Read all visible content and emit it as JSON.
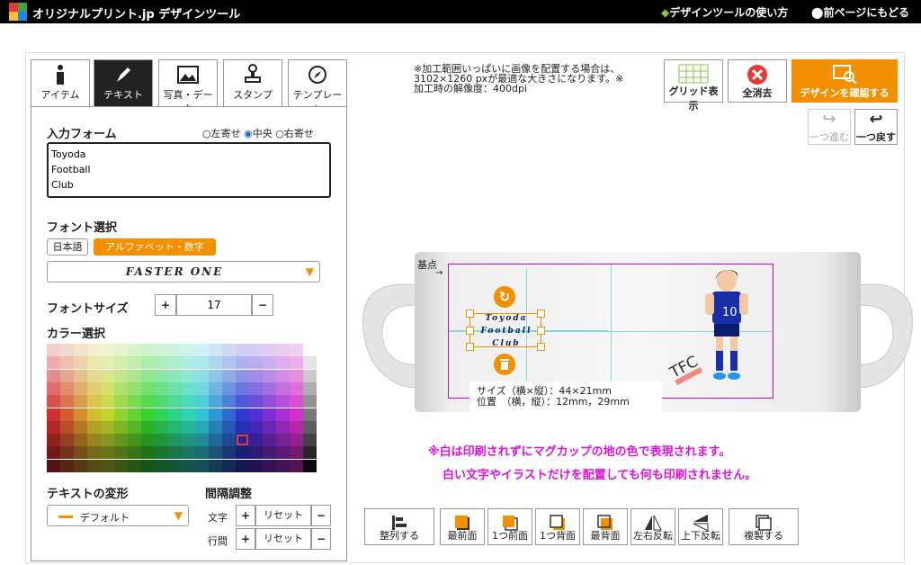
{
  "header": {
    "brand": "オリジナルプリント.jp",
    "app_title": "デザインツール",
    "help_link": "デザインツールの使い方",
    "back_link": "前ページにもどる"
  },
  "tool_tabs": [
    {
      "label": "アイテム",
      "icon": "info-icon"
    },
    {
      "label": "テキスト",
      "icon": "pen-icon"
    },
    {
      "label": "写真・データ",
      "icon": "image-icon"
    },
    {
      "label": "スタンプ",
      "icon": "stamp-icon"
    },
    {
      "label": "テンプレート",
      "icon": "compass-icon"
    }
  ],
  "text_panel": {
    "input_label": "入力フォーム",
    "align_left": "左寄せ",
    "align_center": "中央",
    "align_right": "右寄せ",
    "input_value": "Toyoda\nFootball\nClub",
    "font_label": "フォント選択",
    "font_tab_ja": "日本語",
    "font_tab_alpha": "アルファベット・数字",
    "font_value": "Faster One",
    "size_label": "フォントサイズ",
    "size_value": "17",
    "color_label": "カラー選択",
    "transform_label": "テキストの変形",
    "transform_value": "デフォルト",
    "spacing_label": "間隔調整",
    "char_label": "文字",
    "line_label": "行間",
    "reset": "リセット",
    "plus": "+",
    "minus": "−"
  },
  "notice": "※加工範囲いっぱいに画像を配置する場合は、3102×1260 pxが最適な大きさになります。※加工時の解像度：400dpi",
  "toolbar": {
    "grid": "グリッド表示",
    "clear": "全消去",
    "confirm": "デザインを確認する",
    "redo": "一つ進む",
    "undo": "一つ戻す"
  },
  "canvas": {
    "origin_label": "基点",
    "design_lines": [
      "Toyoda",
      "Football",
      "Club"
    ],
    "size_info": "サイズ（横×縦）：44×21mm",
    "position_info": "位置　（横，縦）：12mm，29mm",
    "player_number": "10",
    "badge_text": "TFC"
  },
  "warnings": {
    "line1": "※白は印刷されずにマグカップの地の色で表現されます。",
    "line2": "白い文字やイラストだけを配置しても何も印刷されません。"
  },
  "bottom_buttons": [
    {
      "label": "整列する"
    },
    {
      "label": "最前面"
    },
    {
      "label": "1つ前面"
    },
    {
      "label": "1つ背面"
    },
    {
      "label": "最背面"
    },
    {
      "label": "左右反転"
    },
    {
      "label": "上下反転"
    },
    {
      "label": "複製する"
    }
  ],
  "colors": {
    "accent": "#f29000",
    "magenta": "#e010e0",
    "jersey": "#1a2ea8"
  }
}
